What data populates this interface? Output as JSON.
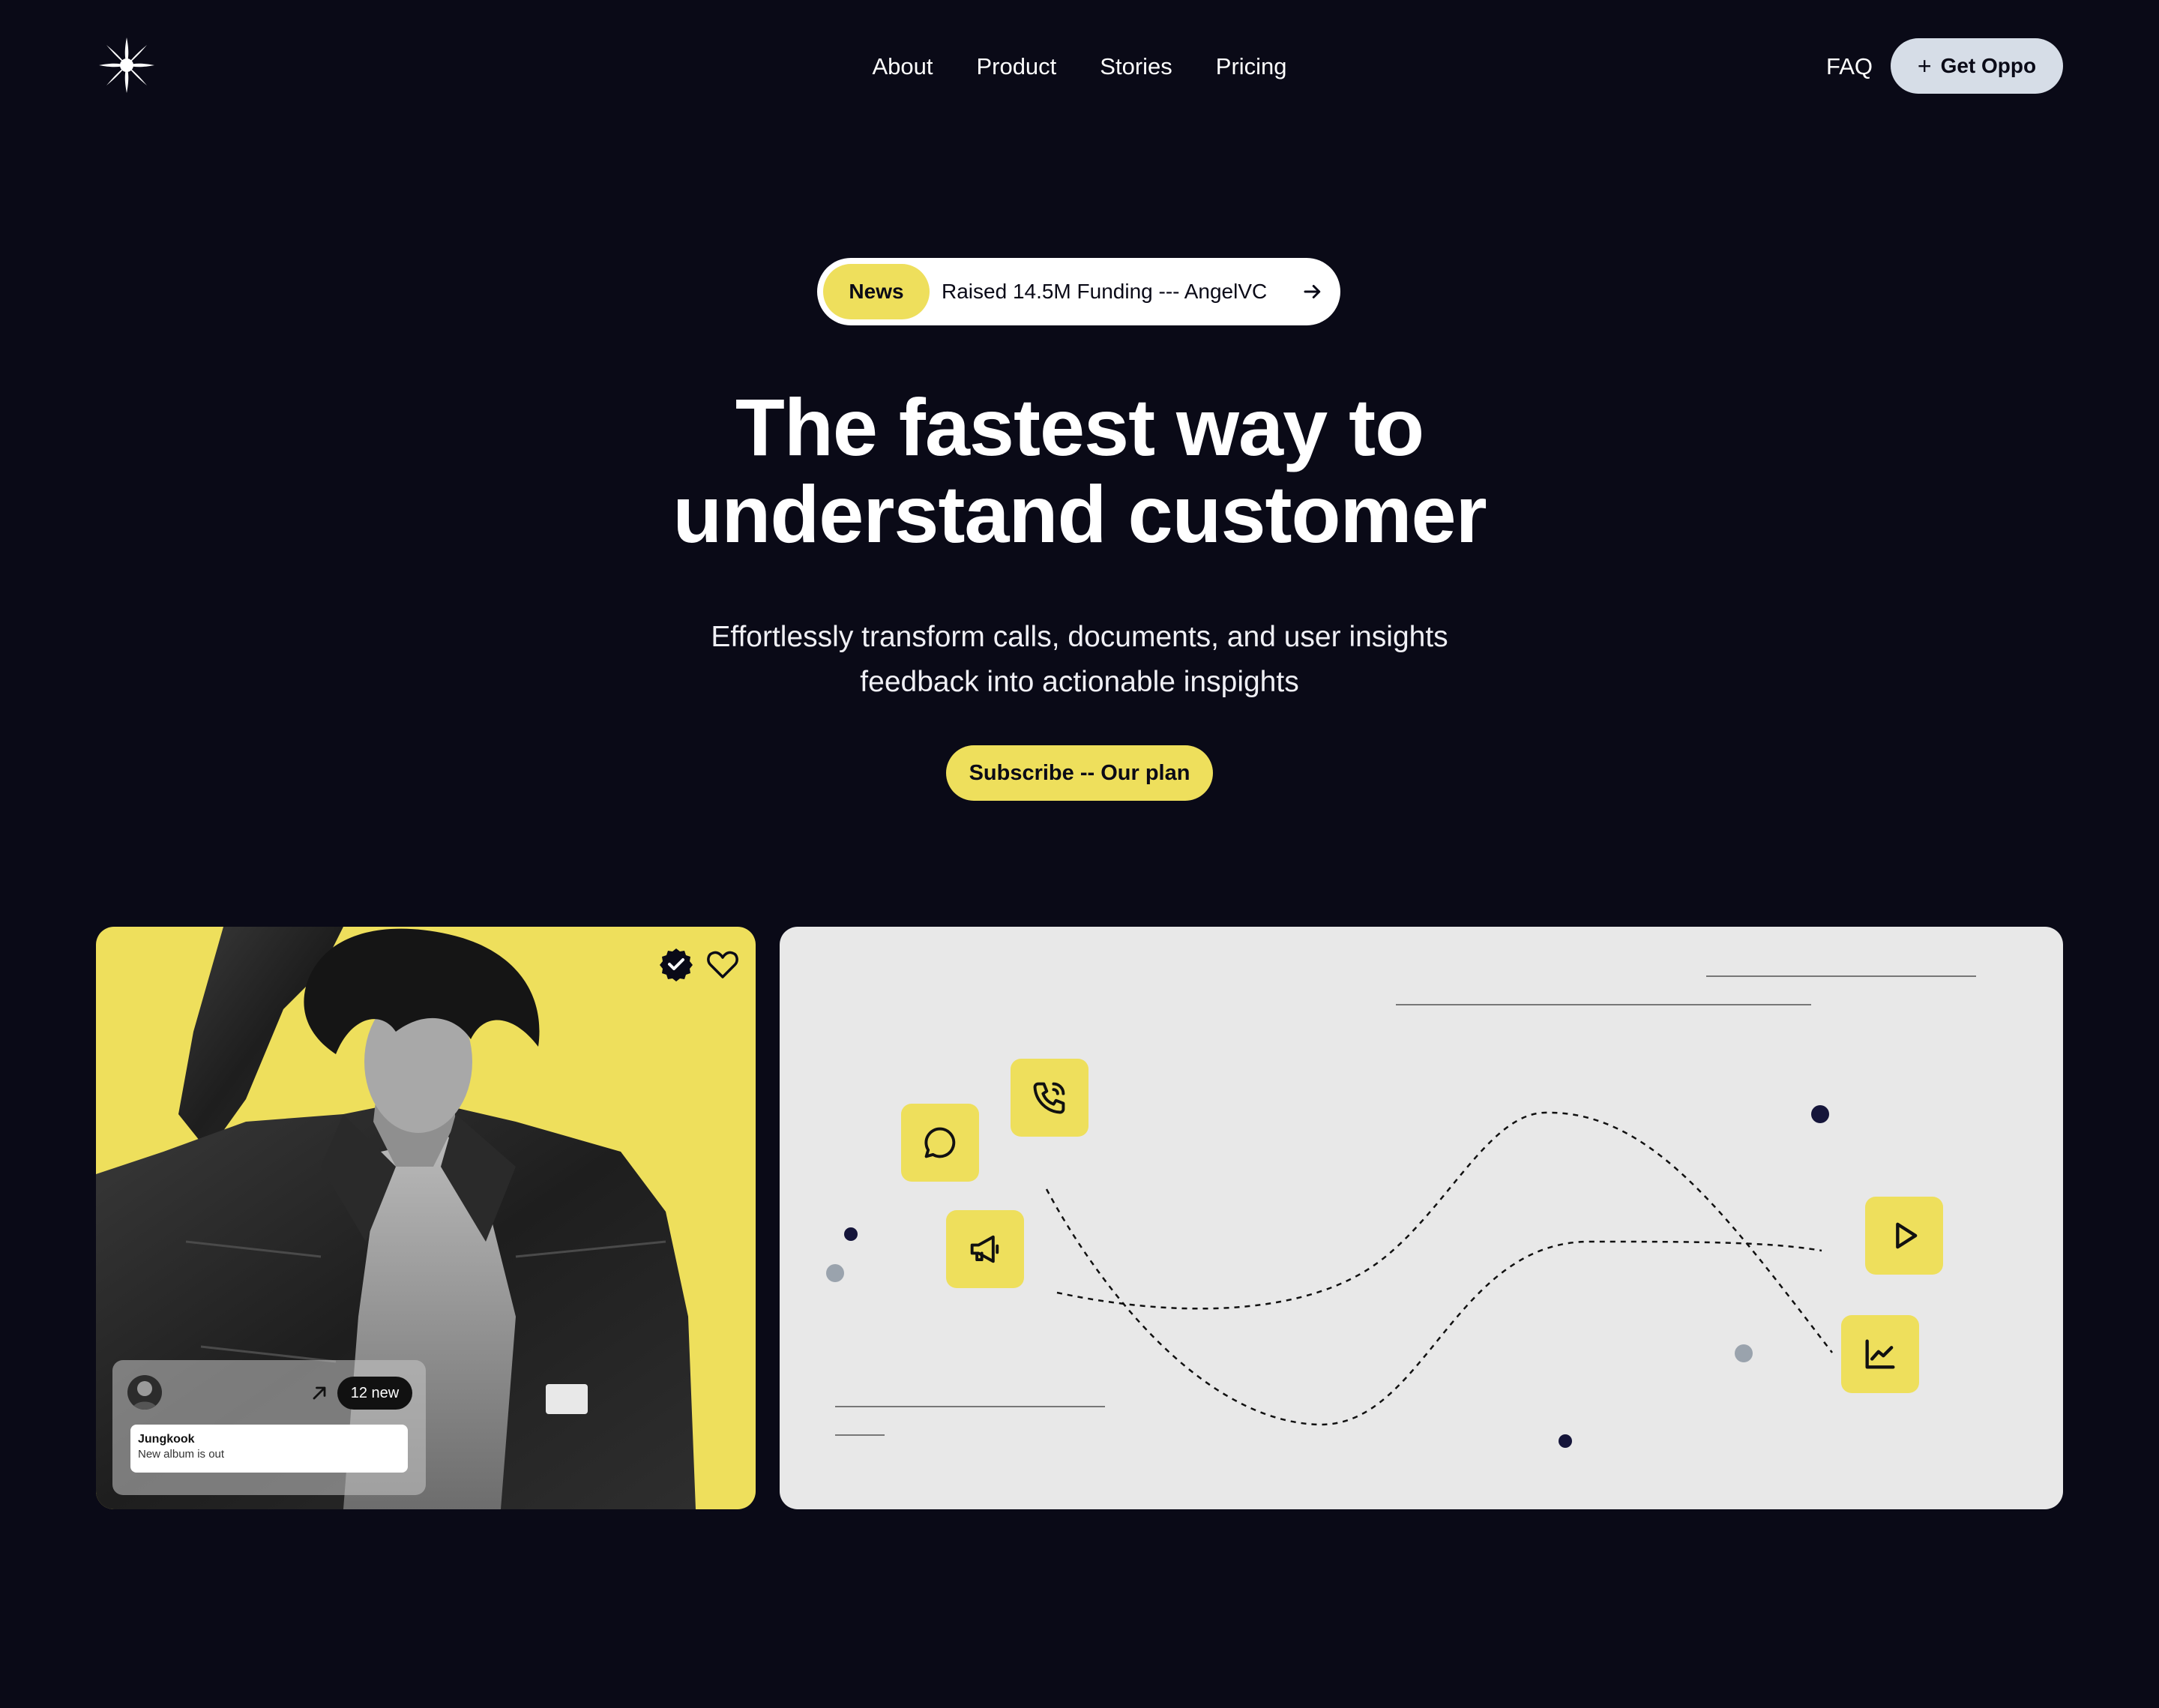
{
  "nav": {
    "links": [
      "About",
      "Product",
      "Stories",
      "Pricing"
    ],
    "faq": "FAQ",
    "cta_label": "Get Oppo",
    "cta_icon": "plus-icon"
  },
  "news": {
    "badge": "News",
    "text_prefix": "Raised ",
    "amount": "14.5M",
    "text_suffix": " Funding --- AngelVC"
  },
  "hero": {
    "headline_line1": "The fastest way to",
    "headline_line2": "understand customer",
    "subtitle_line1": "Effortlessly transform calls, documents, and user insights",
    "subtitle_line2": "feedback into actionable inspights",
    "cta_label": "Subscribe -- Our plan"
  },
  "profile_card": {
    "notification": {
      "badge": "12 new",
      "name": "Jungkook",
      "message": "New album is out"
    }
  },
  "colors": {
    "background": "#0a0a17",
    "accent_yellow": "#eedf5c",
    "panel_gray": "#e8e8e8",
    "button_gray": "#d6dde7"
  },
  "icons": [
    "star-logo-icon",
    "arrow-right-icon",
    "verified-icon",
    "heart-icon",
    "arrow-up-right-icon",
    "chat-bubble-icon",
    "phone-icon",
    "megaphone-icon",
    "play-icon",
    "line-chart-icon"
  ]
}
